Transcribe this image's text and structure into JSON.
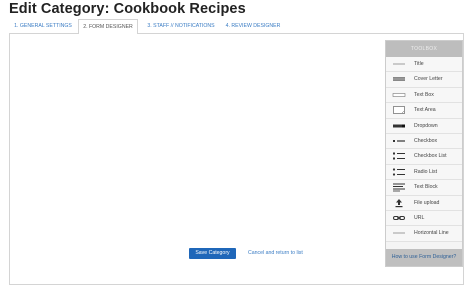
{
  "page": {
    "title": "Edit Category: Cookbook Recipes"
  },
  "tabs": [
    {
      "label": "1. GENERAL SETTINGS"
    },
    {
      "label": "2. FORM DESIGNER"
    },
    {
      "label": "3. STAFF // NOTIFICATIONS"
    },
    {
      "label": "4. REVIEW DESIGNER"
    }
  ],
  "active_tab": "2. FORM DESIGNER",
  "form": {
    "save_label": "Save Category",
    "cancel_label": "Cancel and return to list"
  },
  "toolbox": {
    "header": "TOOLBOX",
    "items": [
      {
        "label": "Title",
        "icon": "title-line-icon"
      },
      {
        "label": "Cover Letter",
        "icon": "cover-letter-icon"
      },
      {
        "label": "Text Box",
        "icon": "text-box-icon"
      },
      {
        "label": "Text Area",
        "icon": "text-area-icon"
      },
      {
        "label": "Dropdown",
        "icon": "dropdown-icon"
      },
      {
        "label": "Checkbox",
        "icon": "checkbox-icon"
      },
      {
        "label": "Checkbox List",
        "icon": "checkbox-list-icon"
      },
      {
        "label": "Radio List",
        "icon": "radio-list-icon"
      },
      {
        "label": "Text Block",
        "icon": "text-block-icon"
      },
      {
        "label": "File upload",
        "icon": "file-upload-icon"
      },
      {
        "label": "URL",
        "icon": "link-icon"
      },
      {
        "label": "Horizontal Line",
        "icon": "horizontal-line-icon"
      }
    ],
    "help_label": "How to use Form Designer?"
  },
  "colors": {
    "accent": "#1f67b9",
    "link": "#3a7cc4",
    "toolbox_header": "#bdbdbd",
    "toolbox_footer": "#bfbfbf"
  }
}
